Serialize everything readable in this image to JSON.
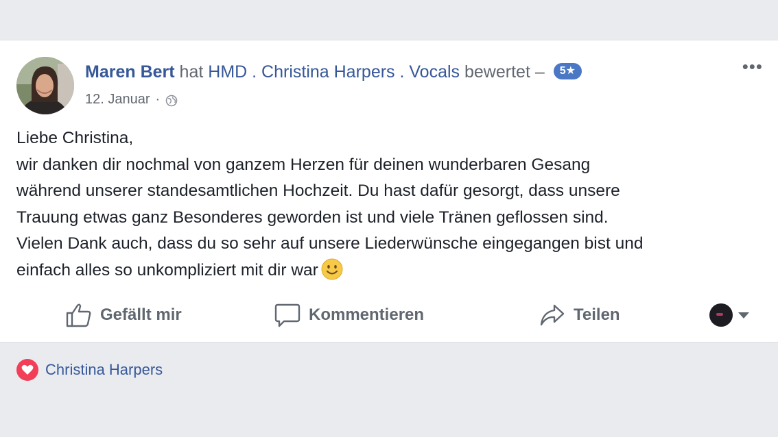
{
  "post": {
    "author": "Maren Bert",
    "verb_prefix": "hat",
    "page_name": "HMD . Christina Harpers . Vocals",
    "verb_suffix": "bewertet –",
    "rating": "5★",
    "date": "12. Januar",
    "separator": "·",
    "privacy_icon": "globe-icon",
    "more_label": "•••",
    "body_lines": [
      "Liebe Christina,",
      "wir danken dir nochmal von ganzem Herzen für deinen wunderbaren Gesang",
      "während unserer standesamtlichen Hochzeit. Du hast dafür gesorgt, dass unsere",
      "Trauung etwas ganz Besonderes geworden ist und viele Tränen geflossen sind.",
      "Vielen Dank auch, dass du so sehr auf unsere Liederwünsche eingegangen bist und",
      "einfach alles so unkompliziert mit dir war"
    ],
    "emoji": "smiley-icon"
  },
  "actions": {
    "like_label": "Gefällt mir",
    "comment_label": "Kommentieren",
    "share_label": "Teilen"
  },
  "reactions": {
    "type": "heart-icon",
    "names": "Christina Harpers"
  },
  "colors": {
    "link": "#365899",
    "background": "#e9ebee",
    "badge": "#4b78c4",
    "heart": "#f33e58"
  }
}
